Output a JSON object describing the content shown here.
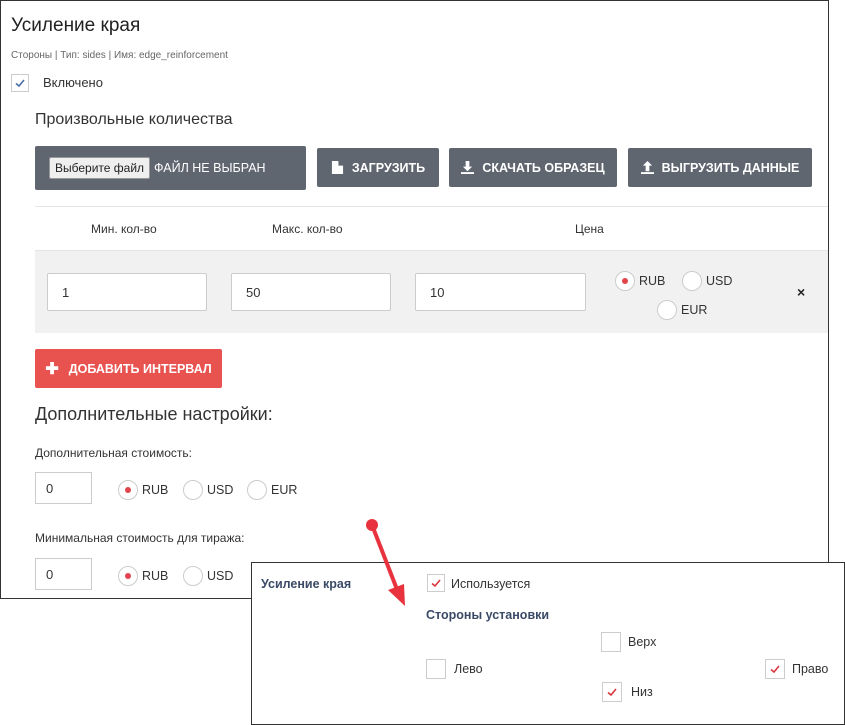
{
  "title": "Усиление края",
  "meta": "Стороны | Тип: sides | Имя: edge_reinforcement",
  "enabled_label": "Включено",
  "custom_section_title": "Произвольные количества",
  "file": {
    "choose_label": "Выберите файл",
    "status": "ФАЙЛ НЕ ВЫБРАН"
  },
  "buttons": {
    "upload": "ЗАГРУЗИТЬ",
    "download_sample": "СКАЧАТЬ ОБРАЗЕЦ",
    "export_data": "ВЫГРУЗИТЬ ДАННЫЕ",
    "add_interval": "ДОБАВИТЬ ИНТЕРВАЛ",
    "remove_row": "×"
  },
  "table": {
    "headers": {
      "min": "Мин. кол-во",
      "max": "Макс. кол-во",
      "price": "Цена"
    },
    "rows": [
      {
        "min": "1",
        "max": "50",
        "price": "10"
      }
    ]
  },
  "currencies": {
    "rub": "RUB",
    "usd": "USD",
    "eur": "EUR"
  },
  "additional": {
    "title": "Дополнительные настройки:",
    "extra_cost_label": "Дополнительная стоимость:",
    "extra_cost_value": "0",
    "min_cost_label": "Минимальная стоимость для тиража:",
    "min_cost_value": "0"
  },
  "popup": {
    "name": "Усиление края",
    "used_label": "Используется",
    "sides_title": "Стороны установки",
    "top": "Верх",
    "left": "Лево",
    "right": "Право",
    "bottom": "Низ"
  },
  "colors": {
    "button_gray": "#5f6670",
    "button_red": "#e8524f",
    "radio_dot": "#e3434b",
    "check_blue": "#4a6fa5",
    "check_red": "#d9363e",
    "arrow_red": "#e8333f"
  }
}
